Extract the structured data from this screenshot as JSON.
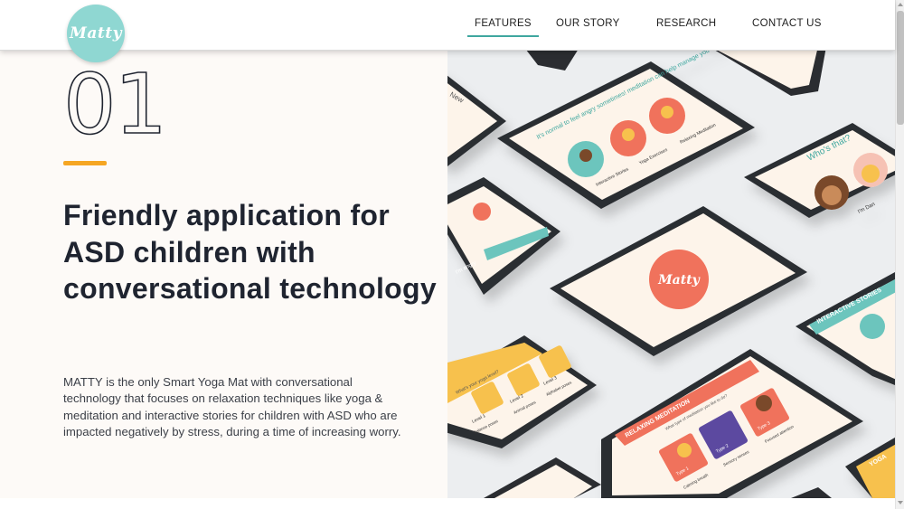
{
  "brand": {
    "logo_text": "Matty",
    "logo_color": "#8fd7d2"
  },
  "nav": {
    "items": [
      {
        "label": "FEATURES",
        "active": true
      },
      {
        "label": "OUR STORY",
        "active": false
      },
      {
        "label": "RESEARCH",
        "active": false
      },
      {
        "label": "CONTACT US",
        "active": false
      }
    ],
    "active_color": "#3fa79f"
  },
  "section": {
    "number": "01",
    "accent_color": "#f5a623",
    "headline": "Friendly application for ASD children with conversational technology",
    "description": "MATTY is the only Smart Yoga Mat with conversational technology that focuses on relaxation techniques like yoga & meditation and interactive stories for children with ASD who are impacted negatively by stress, during a time of increasing worry."
  },
  "hero": {
    "center_logo": "Matty",
    "screens": {
      "meditation_prompt": "It's normal to feel angry sometimes! meditation can help manage you anger.",
      "card_interactive_stories": "Interactive Stories",
      "card_yoga_exercises": "Yoga Exercises",
      "card_relaxing_meditation": "Relaxing Meditation",
      "who_title": "Who's that?",
      "who_name": "I'm Dan",
      "interactive_stories_banner": "INTERACTIVE STORIES",
      "relaxing_meditation_banner": "RELAXING MEDITATION",
      "meditation_question": "What type of meditation you like to do?",
      "type_1": "Type 1",
      "type_2": "Type 2",
      "type_3": "Type 3",
      "calming_breath": "Calming breath",
      "sensory_senses": "Sensory senses",
      "focused_attention": "Focused attention",
      "yoga_level_question": "What's your yoga level?",
      "level_1": "Level 1",
      "level_2": "Level 2",
      "level_3": "Level 3",
      "balance_poses": "Balance poses",
      "animal_poses": "Animal poses",
      "alphabet_poses": "Alphabet poses",
      "im_angry": "I'm angry",
      "yoga_banner": "YOGA",
      "new_label": "New"
    },
    "colors": {
      "coral": "#f0725c",
      "teal": "#6cc5bd",
      "cream": "#fdf4ea",
      "yellow": "#f7c14d",
      "tablet": "#2b2d31"
    }
  },
  "icons": {
    "logo": "matty-logo-badge",
    "scroll_up": "scroll-up-icon",
    "scroll_down": "scroll-down-icon"
  }
}
